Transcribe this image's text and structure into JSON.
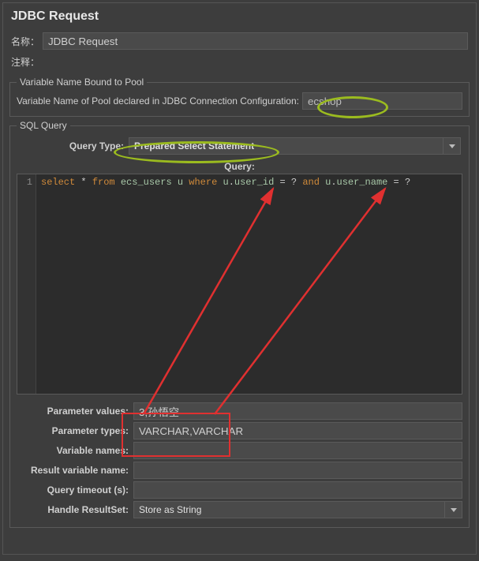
{
  "title": "JDBC Request",
  "name_label": "名称：",
  "name_value": "JDBC Request",
  "comment_label": "注释：",
  "pool_section": {
    "legend": "Variable Name Bound to Pool",
    "label": "Variable Name of Pool declared in JDBC Connection Configuration:",
    "value": "ecshop"
  },
  "sql_section": {
    "legend": "SQL Query",
    "query_type_label": "Query Type:",
    "query_type_value": "Prepared Select Statement",
    "query_label": "Query:",
    "line_no": "1",
    "sql_tokens": {
      "select": "select",
      "star": " * ",
      "from": "from",
      "tbl": " ecs_users u ",
      "where": "where",
      "c1a": " u",
      "c1b": "user_id ",
      "eq1": "= ? ",
      "and": "and",
      "c2a": " u",
      "c2b": "user_name ",
      "eq2": "= ?"
    },
    "params": {
      "values_label": "Parameter values:",
      "values": "3,孙悟空",
      "types_label": "Parameter types:",
      "types": "VARCHAR,VARCHAR",
      "varnames_label": "Variable names:",
      "varnames": "",
      "resultvar_label": "Result variable name:",
      "resultvar": "",
      "timeout_label": "Query timeout (s):",
      "timeout": "",
      "handle_label": "Handle ResultSet:",
      "handle_value": "Store as String"
    }
  }
}
